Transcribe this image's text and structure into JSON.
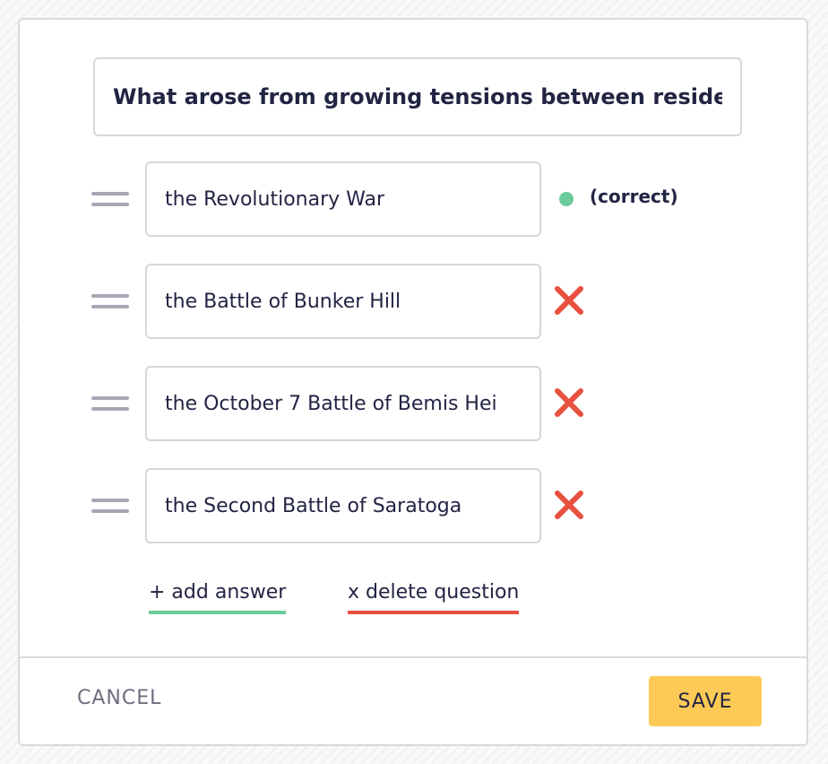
{
  "question": {
    "value": "What arose from growing tensions between reside"
  },
  "answers": [
    {
      "value": "the Revolutionary War",
      "correct": true,
      "correct_label": "(correct)"
    },
    {
      "value": "the Battle of Bunker Hill",
      "correct": false
    },
    {
      "value": "the October 7 Battle of Bemis Hei",
      "correct": false
    },
    {
      "value": "the Second Battle of Saratoga",
      "correct": false
    }
  ],
  "actions": {
    "add_answer": "+ add answer",
    "delete_question": "x delete question"
  },
  "footer": {
    "cancel": "CANCEL",
    "save": "SAVE"
  },
  "colors": {
    "correct": "#6ccb9b",
    "wrong": "#e8513f",
    "save": "#fdcb55",
    "text": "#222443"
  },
  "icons": {
    "drag": "drag-handle-icon",
    "correct": "green-dot-icon",
    "wrong": "red-x-icon"
  }
}
